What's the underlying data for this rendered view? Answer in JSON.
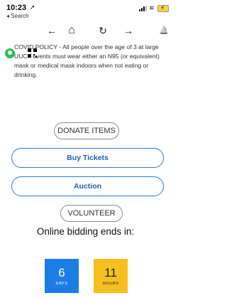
{
  "status_bar": {
    "time": "10:23",
    "location_glyph": "➚",
    "back_label": "◂ Search"
  },
  "toolbar": {
    "back_arrow": "←",
    "home": "⌂",
    "reload": "↻",
    "forward_arrow": "→",
    "bell": "🔔"
  },
  "policy_text": "COVID POLICY - All people over the age of 3 at large UUCF events must wear either an N95 (or equivalent) mask or medical mask indoors when not eating or drinking.",
  "buttons": {
    "donate": "DONATE ITEMS",
    "buy_tickets": "Buy Tickets",
    "auction": "Auction",
    "volunteer": "VOLUNTEER"
  },
  "countdown": {
    "heading": "Online bidding ends in:",
    "days_value": "6",
    "days_label": "DAYS",
    "hours_value": "11",
    "hours_label": "HOURS"
  },
  "colors": {
    "accent_blue": "#2f7bd6",
    "days_tile": "#1a7ee6",
    "hours_tile": "#f6c021",
    "avatar_green": "#2dbb54"
  }
}
